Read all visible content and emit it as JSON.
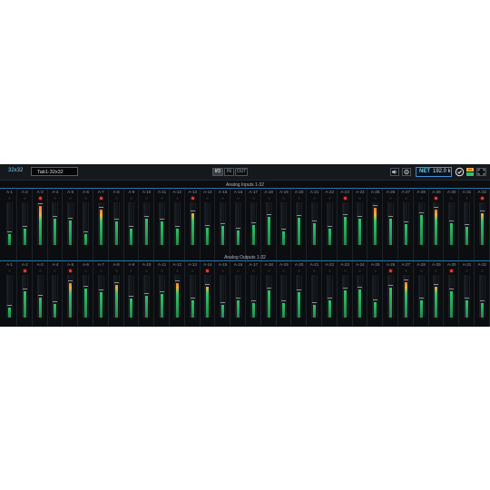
{
  "header": {
    "preset_label": "32x32",
    "tab_name": "Tab1-32x32",
    "view_buttons": [
      "I/O",
      "IN",
      "OUT"
    ],
    "active_view": "I/O",
    "net_label": "NET",
    "sample_rate": "192.0 k"
  },
  "sections": [
    {
      "title": "Analog Inputs 1-32",
      "channels": [
        {
          "label": "A-1",
          "level": 0.25,
          "clip": false
        },
        {
          "label": "A-2",
          "level": 0.38,
          "clip": false
        },
        {
          "label": "A-3",
          "level": 0.92,
          "clip": true
        },
        {
          "label": "A-4",
          "level": 0.62,
          "clip": false
        },
        {
          "label": "A-5",
          "level": 0.58,
          "clip": false
        },
        {
          "label": "A-6",
          "level": 0.26,
          "clip": false
        },
        {
          "label": "A-7",
          "level": 0.84,
          "clip": true
        },
        {
          "label": "A-8",
          "level": 0.55,
          "clip": false
        },
        {
          "label": "A-9",
          "level": 0.38,
          "clip": false
        },
        {
          "label": "A-10",
          "level": 0.62,
          "clip": false
        },
        {
          "label": "A-11",
          "level": 0.56,
          "clip": false
        },
        {
          "label": "A-12",
          "level": 0.38,
          "clip": false
        },
        {
          "label": "A-13",
          "level": 0.74,
          "clip": true
        },
        {
          "label": "A-14",
          "level": 0.4,
          "clip": false
        },
        {
          "label": "A-15",
          "level": 0.45,
          "clip": false
        },
        {
          "label": "A-16",
          "level": 0.35,
          "clip": false
        },
        {
          "label": "A-17",
          "level": 0.46,
          "clip": false
        },
        {
          "label": "A-18",
          "level": 0.66,
          "clip": false
        },
        {
          "label": "A-19",
          "level": 0.32,
          "clip": false
        },
        {
          "label": "A-20",
          "level": 0.63,
          "clip": false
        },
        {
          "label": "A-21",
          "level": 0.5,
          "clip": false
        },
        {
          "label": "A-22",
          "level": 0.38,
          "clip": false
        },
        {
          "label": "A-23",
          "level": 0.65,
          "clip": true
        },
        {
          "label": "A-24",
          "level": 0.62,
          "clip": false
        },
        {
          "label": "A-25",
          "level": 0.88,
          "clip": false
        },
        {
          "label": "A-26",
          "level": 0.62,
          "clip": false
        },
        {
          "label": "A-27",
          "level": 0.48,
          "clip": false
        },
        {
          "label": "A-28",
          "level": 0.7,
          "clip": false
        },
        {
          "label": "A-29",
          "level": 0.82,
          "clip": true
        },
        {
          "label": "A-30",
          "level": 0.5,
          "clip": false
        },
        {
          "label": "A-31",
          "level": 0.42,
          "clip": false
        },
        {
          "label": "A-32",
          "level": 0.74,
          "clip": true
        }
      ]
    },
    {
      "title": "Analog Outputs 1-32",
      "channels": [
        {
          "label": "A-1",
          "level": 0.24,
          "clip": false
        },
        {
          "label": "A-2",
          "level": 0.62,
          "clip": true
        },
        {
          "label": "A-3",
          "level": 0.46,
          "clip": false
        },
        {
          "label": "A-4",
          "level": 0.32,
          "clip": false
        },
        {
          "label": "A-5",
          "level": 0.8,
          "clip": true
        },
        {
          "label": "A-6",
          "level": 0.68,
          "clip": false
        },
        {
          "label": "A-7",
          "level": 0.6,
          "clip": false
        },
        {
          "label": "A-8",
          "level": 0.76,
          "clip": false
        },
        {
          "label": "A-9",
          "level": 0.44,
          "clip": false
        },
        {
          "label": "A-10",
          "level": 0.52,
          "clip": false
        },
        {
          "label": "A-11",
          "level": 0.56,
          "clip": false
        },
        {
          "label": "A-12",
          "level": 0.8,
          "clip": false
        },
        {
          "label": "A-13",
          "level": 0.4,
          "clip": false
        },
        {
          "label": "A-14",
          "level": 0.72,
          "clip": true
        },
        {
          "label": "A-15",
          "level": 0.3,
          "clip": false
        },
        {
          "label": "A-16",
          "level": 0.4,
          "clip": false
        },
        {
          "label": "A-17",
          "level": 0.34,
          "clip": false
        },
        {
          "label": "A-18",
          "level": 0.64,
          "clip": false
        },
        {
          "label": "A-19",
          "level": 0.34,
          "clip": false
        },
        {
          "label": "A-20",
          "level": 0.6,
          "clip": false
        },
        {
          "label": "A-21",
          "level": 0.3,
          "clip": false
        },
        {
          "label": "A-22",
          "level": 0.4,
          "clip": false
        },
        {
          "label": "A-23",
          "level": 0.64,
          "clip": false
        },
        {
          "label": "A-24",
          "level": 0.66,
          "clip": false
        },
        {
          "label": "A-25",
          "level": 0.36,
          "clip": false
        },
        {
          "label": "A-26",
          "level": 0.7,
          "clip": true
        },
        {
          "label": "A-27",
          "level": 0.82,
          "clip": false
        },
        {
          "label": "A-28",
          "level": 0.4,
          "clip": false
        },
        {
          "label": "A-29",
          "level": 0.72,
          "clip": false
        },
        {
          "label": "A-30",
          "level": 0.62,
          "clip": true
        },
        {
          "label": "A-31",
          "level": 0.4,
          "clip": false
        },
        {
          "label": "A-32",
          "level": 0.34,
          "clip": false
        }
      ]
    }
  ],
  "colors": {
    "meter_low": "#1f8a4a",
    "meter_mid": "#2fc46a",
    "meter_hot": "#e9b53a",
    "meter_peak": "#ff7a2a",
    "clip_on": "#ff3b2f",
    "accent": "#3f8fd0"
  },
  "icons": {
    "speaker": "speaker-icon",
    "settings": "gear-icon",
    "sync": "sync-icon",
    "status": "status-icon",
    "fullscreen": "fullscreen-icon"
  }
}
